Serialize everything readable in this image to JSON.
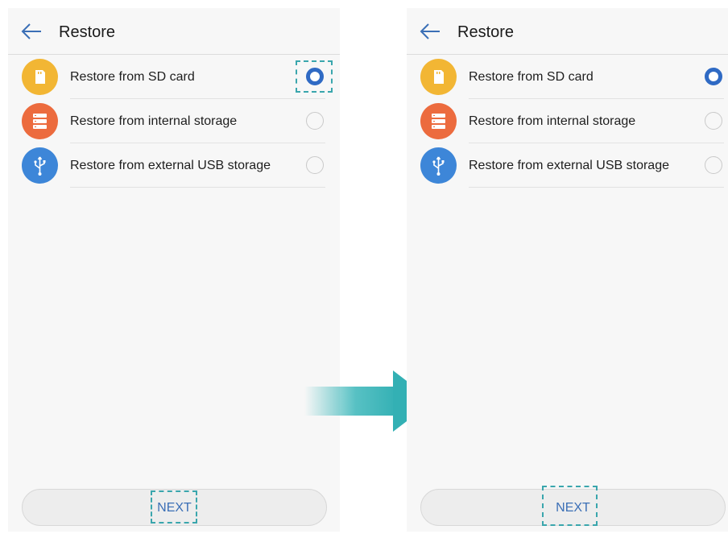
{
  "screens": [
    {
      "header": {
        "title": "Restore",
        "back_icon": "arrow-left-icon"
      },
      "options": [
        {
          "label": "Restore from SD card",
          "icon": "sd-card-icon",
          "selected": true
        },
        {
          "label": "Restore from internal storage",
          "icon": "internal-storage-icon",
          "selected": false
        },
        {
          "label": "Restore from external USB storage",
          "icon": "usb-icon",
          "selected": false
        }
      ],
      "next_label": "NEXT",
      "highlights": [
        "sd-card-radio",
        "next-button"
      ]
    },
    {
      "header": {
        "title": "Restore",
        "back_icon": "arrow-left-icon"
      },
      "options": [
        {
          "label": "Restore from SD card",
          "icon": "sd-card-icon",
          "selected": true
        },
        {
          "label": "Restore from internal storage",
          "icon": "internal-storage-icon",
          "selected": false
        },
        {
          "label": "Restore from external USB storage",
          "icon": "usb-icon",
          "selected": false
        }
      ],
      "next_label": "NEXT",
      "highlights": [
        "next-button"
      ]
    }
  ],
  "colors": {
    "accent_blue": "#2f6ac4",
    "highlight_teal": "#3aa6ad",
    "sd_icon": "#f2b634",
    "internal_icon": "#ec6b3e",
    "usb_icon": "#3d86d8"
  },
  "transition_arrow_icon": "arrow-right-icon"
}
